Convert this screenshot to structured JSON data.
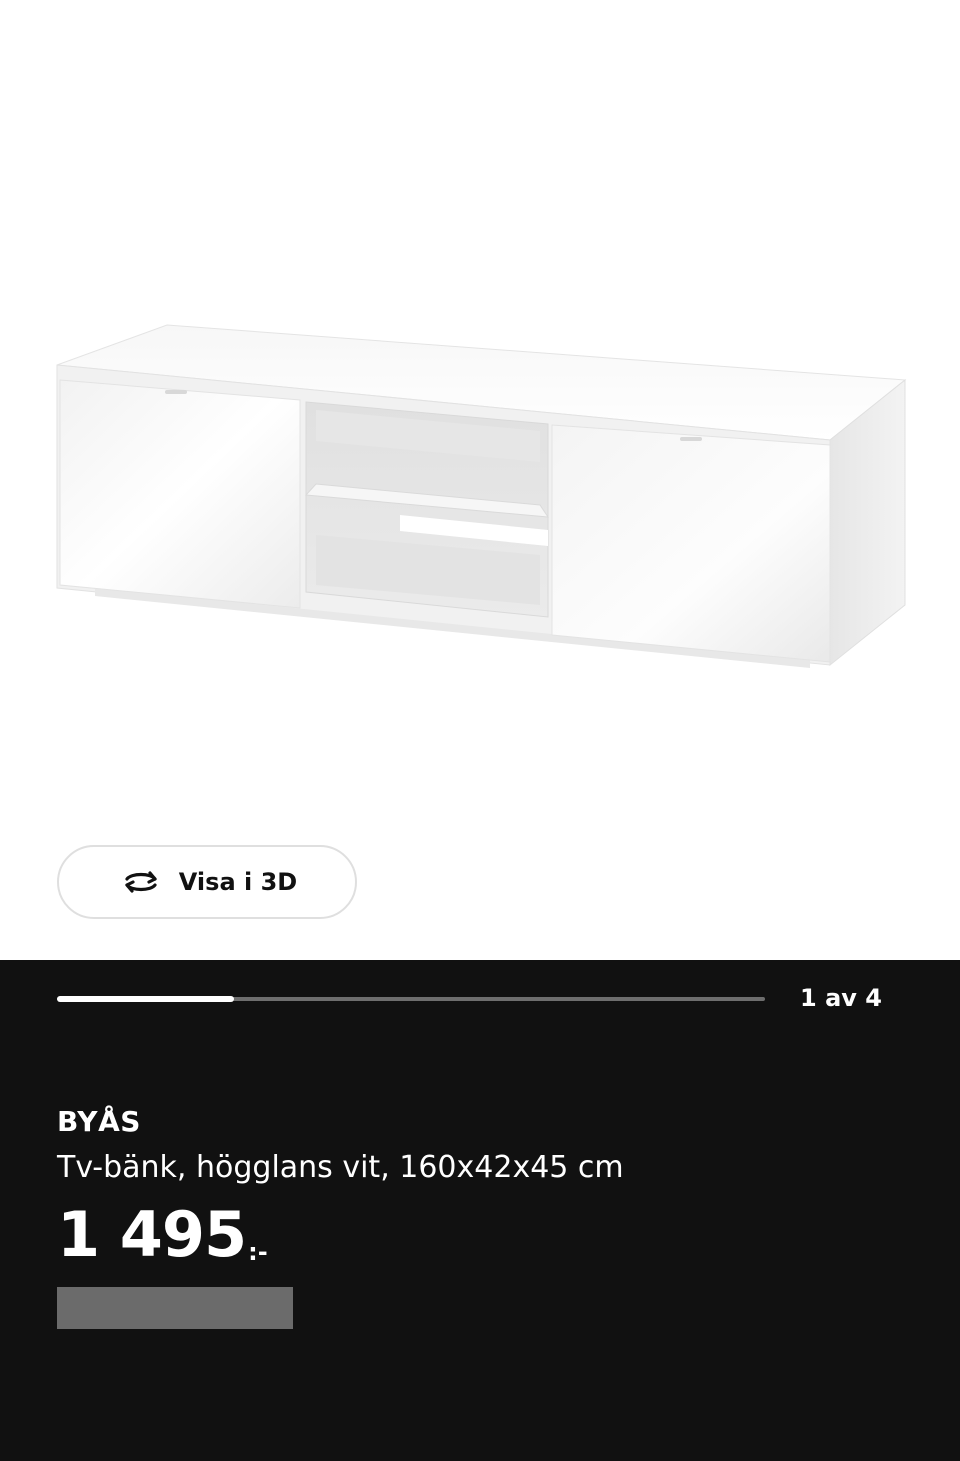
{
  "product_image": {
    "alt": "BYÅS Tv-bänk, högglans vit"
  },
  "view3d": {
    "label": "Visa i 3D",
    "icon": "rotate-3d-icon"
  },
  "gallery": {
    "counter": "1 av 4",
    "progress": 0.25
  },
  "product": {
    "name": "BYÅS",
    "description": "Tv-bänk, högglans vit, 160x42x45 cm",
    "price": "1 495",
    "price_suffix": ":-"
  },
  "colors": {
    "panel_background": "#111111",
    "progress_track": "#6e6e6e",
    "progress_fill": "#ffffff",
    "redacted": "#6b6b6b"
  }
}
